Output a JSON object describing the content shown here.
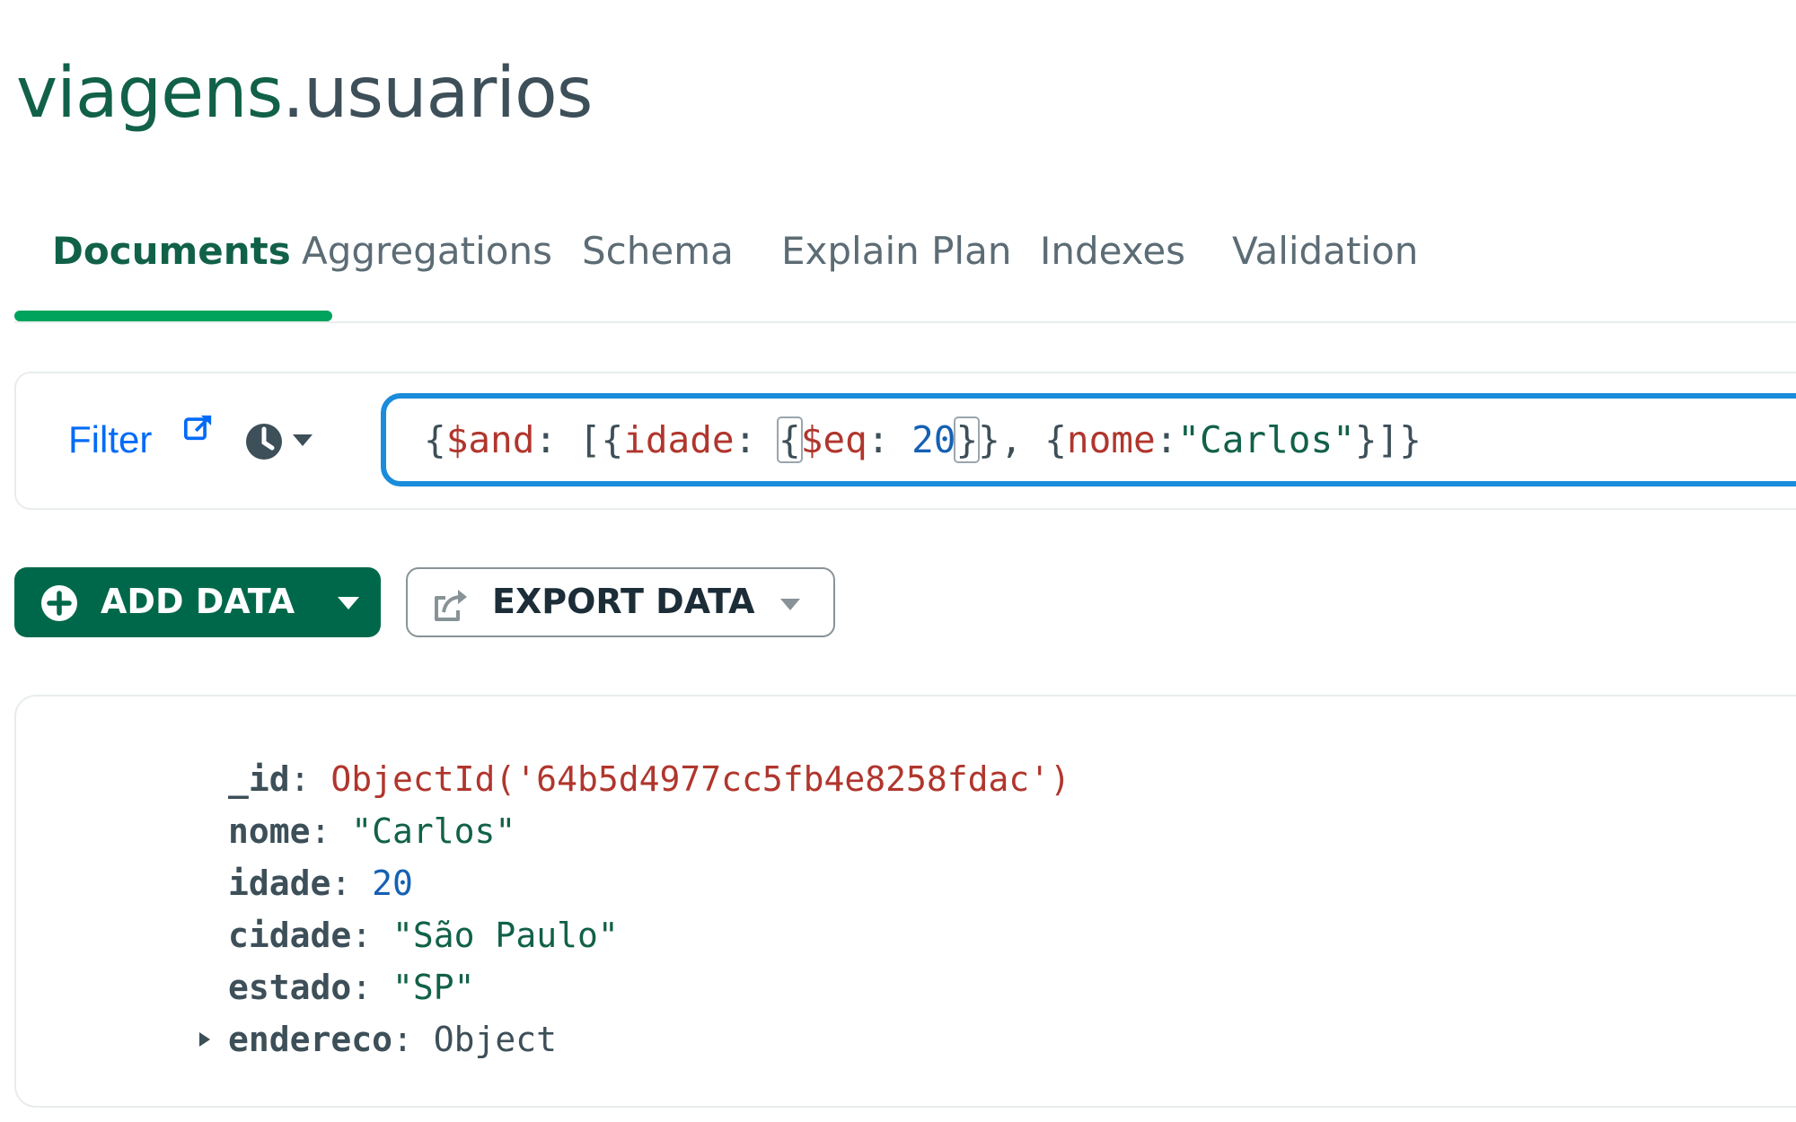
{
  "header": {
    "db": "viagens",
    "sep": ".",
    "collection": "usuarios"
  },
  "tabs": [
    {
      "label": "Documents",
      "active": true
    },
    {
      "label": "Aggregations",
      "active": false
    },
    {
      "label": "Schema",
      "active": false
    },
    {
      "label": "Explain Plan",
      "active": false
    },
    {
      "label": "Indexes",
      "active": false
    },
    {
      "label": "Validation",
      "active": false
    }
  ],
  "filter": {
    "label": "Filter",
    "link_icon": "external-link-icon",
    "history_icon": "clock-icon",
    "query": {
      "p1": "{",
      "k1": "$and",
      "p2": ": [{",
      "k2": "idade",
      "p3": ": ",
      "b1": "{",
      "k3": "$eq",
      "p4": ": ",
      "n1": "20",
      "b2": "}",
      "p5": "}, {",
      "k4": "nome",
      "p6": ":",
      "s1": "\"Carlos\"",
      "p7": "}]}"
    }
  },
  "actions": {
    "add_data": "ADD DATA",
    "export_data": "EXPORT DATA"
  },
  "document": {
    "fields": [
      {
        "key": "_id",
        "colon": ": ",
        "value": "ObjectId('64b5d4977cc5fb4e8258fdac')",
        "type": "oid",
        "expandable": false
      },
      {
        "key": "nome",
        "colon": ": ",
        "value": "\"Carlos\"",
        "type": "str",
        "expandable": false
      },
      {
        "key": "idade",
        "colon": ": ",
        "value": "20",
        "type": "num",
        "expandable": false
      },
      {
        "key": "cidade",
        "colon": ": ",
        "value": "\"São Paulo\"",
        "type": "str",
        "expandable": false
      },
      {
        "key": "estado",
        "colon": ": ",
        "value": "\"SP\"",
        "type": "str",
        "expandable": false
      },
      {
        "key": "endereco",
        "colon": ": ",
        "value": "Object",
        "type": "obj",
        "expandable": true
      }
    ]
  },
  "colors": {
    "brand_green": "#00684a",
    "tab_indicator": "#00a35c",
    "focus_blue": "#1a8cdb",
    "link_blue": "#016bf8"
  }
}
